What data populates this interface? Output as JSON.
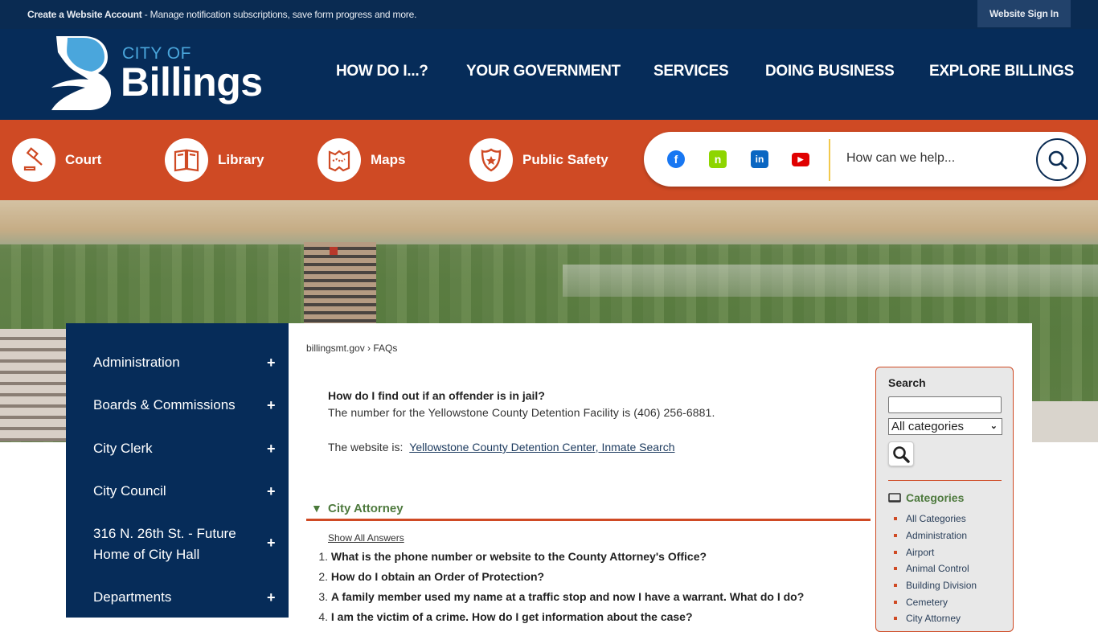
{
  "topbar": {
    "account_link": "Create a Website Account",
    "account_desc": " - Manage notification subscriptions, save form progress and more.",
    "signin": "Website Sign In"
  },
  "header": {
    "logo_city_of": "CITY OF",
    "logo_billings": "Billings",
    "nav": [
      "HOW DO I...?",
      "YOUR GOVERNMENT",
      "SERVICES",
      "DOING BUSINESS",
      "EXPLORE BILLINGS"
    ]
  },
  "quicklinks": [
    {
      "label": "Court",
      "icon": "gavel-icon"
    },
    {
      "label": "Library",
      "icon": "book-icon"
    },
    {
      "label": "Maps",
      "icon": "map-icon"
    },
    {
      "label": "Public Safety",
      "icon": "police-badge-icon"
    }
  ],
  "social": [
    {
      "name": "facebook",
      "glyph": "f",
      "color": "#1877f2"
    },
    {
      "name": "nextdoor",
      "glyph": "n",
      "color": "#8ed500"
    },
    {
      "name": "linkedin",
      "glyph": "in",
      "color": "#0a66c2"
    },
    {
      "name": "youtube",
      "glyph": "▶",
      "color": "#e00000"
    }
  ],
  "site_search": {
    "placeholder": "How can we help..."
  },
  "sidebar": {
    "items": [
      {
        "label": "Administration"
      },
      {
        "label": "Boards & Commissions"
      },
      {
        "label": "City Clerk"
      },
      {
        "label": "City Council"
      },
      {
        "label": "316 N. 26th St. - Future Home of City Hall"
      },
      {
        "label": "Departments"
      }
    ],
    "expand_glyph": "+"
  },
  "breadcrumb": {
    "home": "billingsmt.gov",
    "sep": " › ",
    "current": "FAQs"
  },
  "faq_open": {
    "question": "How do I find out if an offender is in jail?",
    "answer": "The number for the Yellowstone County Detention Facility is (406) 256-6881.",
    "website_prefix": "The website is: ",
    "website_link": "Yellowstone County Detention Center, Inmate Search"
  },
  "category": {
    "toggle_glyph": "▼",
    "name": "City Attorney",
    "show_all": "Show All Answers",
    "questions": [
      {
        "num": "1.",
        "text": "What is the phone number or website to the County Attorney's Office?"
      },
      {
        "num": "2.",
        "text": "How do I obtain an Order of Protection?"
      },
      {
        "num": "3.",
        "text": "A family member used my name at a traffic stop and now I have a warrant. What do I do?"
      },
      {
        "num": "4.",
        "text": "I am the victim of a crime. How do I get information about the case?"
      }
    ]
  },
  "right_panel": {
    "search_title": "Search",
    "search_value": "",
    "category_select": "All categories",
    "categories_title": "Categories",
    "categories": [
      "All Categories",
      "Administration",
      "Airport",
      "Animal Control",
      "Building Division",
      "Cemetery",
      "City Attorney"
    ]
  },
  "colors": {
    "navy": "#062c59",
    "orange": "#cf4a24",
    "green_heading": "#4e7a3e"
  }
}
